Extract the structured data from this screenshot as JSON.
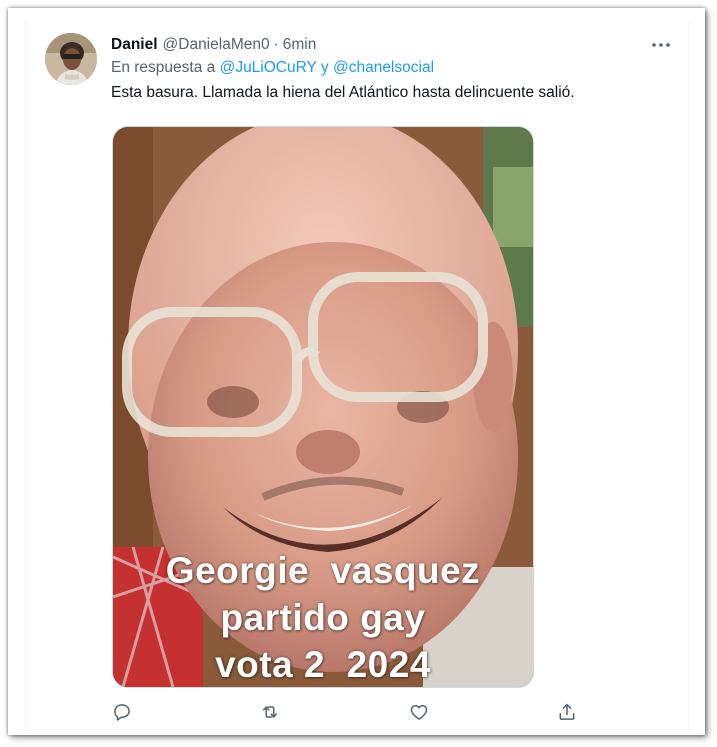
{
  "tweet": {
    "author_name": "Daniel",
    "author_handle": "@DanielaMen0",
    "separator": "·",
    "time": "6min",
    "reply_prefix": "En respuesta a",
    "reply_mentions": [
      "@JuLiOCuRY",
      "@chanelsocial"
    ],
    "reply_conjunction": "y",
    "text": "Esta basura. Llamada la hiena del Atlántico hasta delincuente salió.",
    "media": {
      "caption_lines": [
        "Georgie  vasquez",
        "partido gay",
        "vota 2  2024"
      ]
    },
    "actions": [
      "reply-icon",
      "retweet-icon",
      "like-icon",
      "share-icon"
    ],
    "more_icon": "more-icon"
  },
  "colors": {
    "text_primary": "#0f1419",
    "text_secondary": "#536471",
    "link": "#1d9bf0",
    "border": "#eff3f4"
  }
}
